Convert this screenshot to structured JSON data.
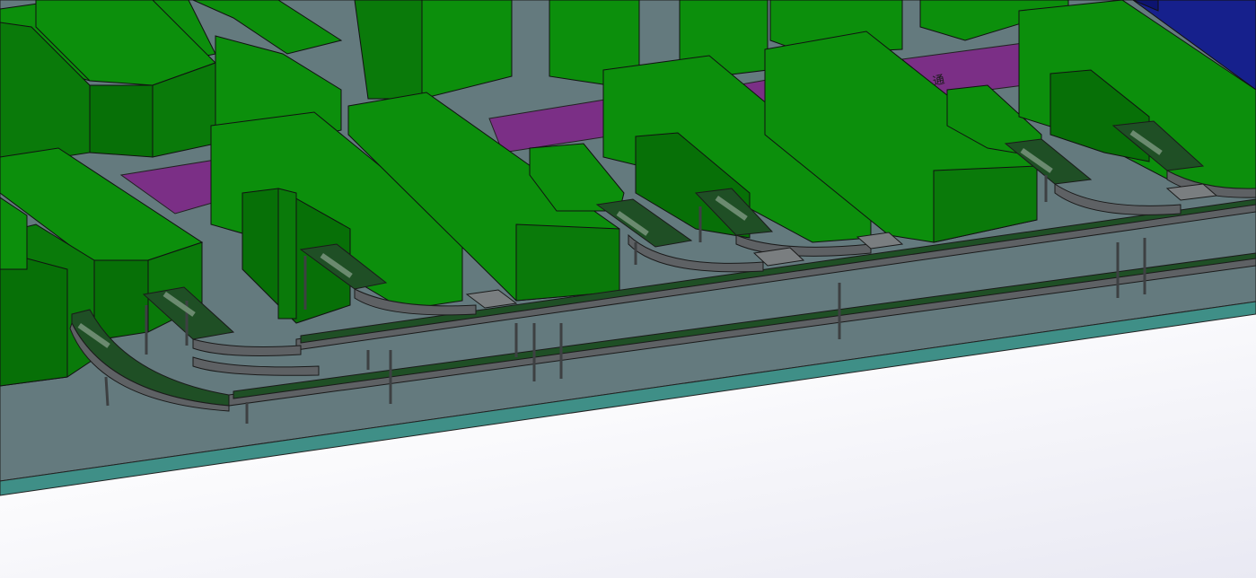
{
  "scene": {
    "kind": "3D CAD model view",
    "colors": {
      "background": "#ffffff",
      "floor_top": "#647a7e",
      "floor_edge": "#3f8f87",
      "machine_top": "#0c8f0c",
      "machine_side": "#0a7a0a",
      "machine_dark": "#077007",
      "walkway": "#7b2f86",
      "wall_block": "#16208c",
      "conveyor_frame": "#5e6164",
      "conveyor_belt": "#1f4f25",
      "outline": "#1a1a1a"
    },
    "walkway_marking": "通"
  }
}
